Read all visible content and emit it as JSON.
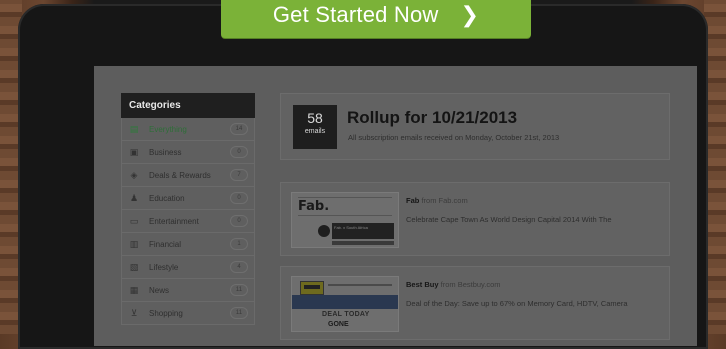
{
  "cta": {
    "label": "Get Started Now",
    "chevron": "❯"
  },
  "sidebar": {
    "heading": "Categories",
    "items": [
      {
        "label": "Everything",
        "count": "14",
        "icon": "inbox-icon",
        "glyph": "▤",
        "active": true
      },
      {
        "label": "Business",
        "count": "0",
        "icon": "briefcase-icon",
        "glyph": "▣",
        "active": false
      },
      {
        "label": "Deals & Rewards",
        "count": "7",
        "icon": "tag-icon",
        "glyph": "◈",
        "active": false
      },
      {
        "label": "Education",
        "count": "0",
        "icon": "graduation-cap-icon",
        "glyph": "♟",
        "active": false
      },
      {
        "label": "Entertainment",
        "count": "0",
        "icon": "monitor-icon",
        "glyph": "▭",
        "active": false
      },
      {
        "label": "Financial",
        "count": "1",
        "icon": "chart-icon",
        "glyph": "▥",
        "active": false
      },
      {
        "label": "Lifestyle",
        "count": "4",
        "icon": "photo-icon",
        "glyph": "▧",
        "active": false
      },
      {
        "label": "News",
        "count": "11",
        "icon": "newspaper-icon",
        "glyph": "▦",
        "active": false
      },
      {
        "label": "Shopping",
        "count": "11",
        "icon": "cart-icon",
        "glyph": "⊻",
        "active": false
      }
    ]
  },
  "rollup": {
    "count": "58",
    "count_unit": "emails",
    "title": "Rollup for 10/21/2013",
    "subtitle": "All subscription emails received on Monday, October 21st, 2013"
  },
  "emails": [
    {
      "sender": "Fab",
      "from_text": "from Fab.com",
      "subject": "Celebrate Cape Town As World Design Capital 2014 With The",
      "thumb": {
        "logo": "Fab.",
        "strip": "Fab. x South Africa"
      }
    },
    {
      "sender": "Best Buy",
      "from_text": "from Bestbuy.com",
      "subject": "Deal of the Day: Save up to 67% on Memory Card, HDTV, Camera",
      "thumb": {
        "deal": "DEAL TODAY",
        "gone": "GONE"
      }
    }
  ],
  "colors": {
    "cta": "#7bb238",
    "active_category": "#2e6e38",
    "overlay_bg": "#5d5d5d"
  }
}
